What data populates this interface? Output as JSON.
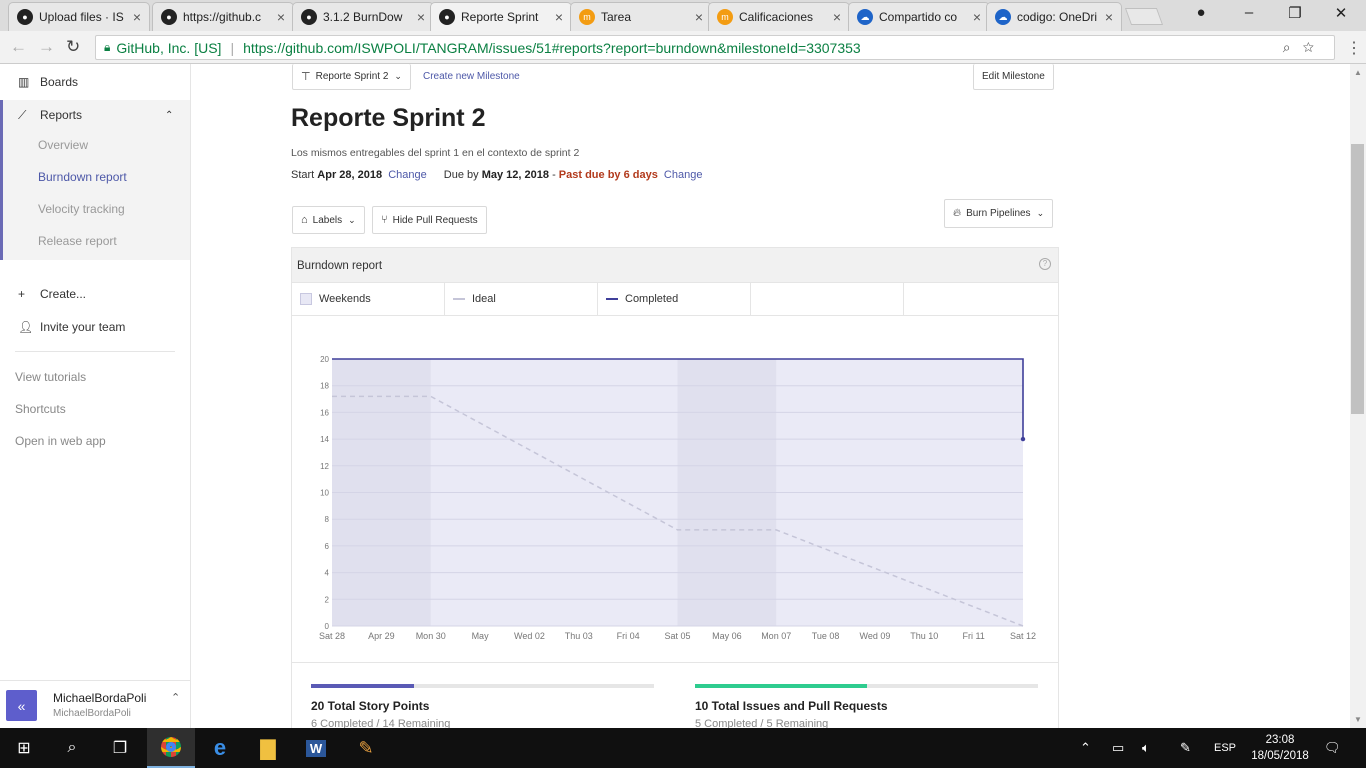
{
  "browser": {
    "tabs": [
      {
        "title": "Upload files · IS",
        "icon": "github-icon"
      },
      {
        "title": "https://github.c",
        "icon": "github-icon"
      },
      {
        "title": "3.1.2 BurnDow",
        "icon": "github-icon"
      },
      {
        "title": "Reporte Sprint",
        "icon": "github-icon",
        "active": true
      },
      {
        "title": "Tarea",
        "icon": "moodle-icon"
      },
      {
        "title": "Calificaciones",
        "icon": "moodle-icon"
      },
      {
        "title": "Compartido co",
        "icon": "onedrive-icon"
      },
      {
        "title": "codigo: OneDri",
        "icon": "onedrive-icon"
      }
    ],
    "site_identity": "GitHub, Inc. [US]",
    "url": "https://github.com/ISWPOLI/TANGRAM/issues/51#reports?report=burndown&milestoneId=3307353"
  },
  "sidebar": {
    "boards": "Boards",
    "reports": "Reports",
    "report_items": [
      "Overview",
      "Burndown report",
      "Velocity tracking",
      "Release report"
    ],
    "active_report": "Burndown report",
    "create": "Create...",
    "invite": "Invite your team",
    "links": [
      "View tutorials",
      "Shortcuts",
      "Open in web app"
    ],
    "user": {
      "name": "MichaelBordaPoli",
      "handle": "MichaelBordaPoli",
      "collapse_glyph": "«"
    }
  },
  "milestone": {
    "selector": "Reporte Sprint 2",
    "create_link": "Create new Milestone",
    "edit_button": "Edit Milestone",
    "title": "Reporte Sprint 2",
    "description": "Los mismos entregables del sprint 1 en el contexto de sprint 2",
    "start_label": "Start",
    "start_date": "Apr 28, 2018",
    "change": "Change",
    "due_label": "Due by",
    "due_date": "May 12, 2018",
    "dash": "-",
    "past_due": "Past due by 6 days"
  },
  "filters": {
    "labels": "Labels",
    "hide_prs": "Hide Pull Requests",
    "burn_pipelines": "Burn Pipelines"
  },
  "report": {
    "title": "Burndown report",
    "help": "?",
    "legend": [
      "Weekends",
      "Ideal",
      "Completed"
    ]
  },
  "colors": {
    "accent": "#4d58a8",
    "completed_line": "#3f3f9a",
    "ideal_line": "#c5c5d8",
    "area_fill": "#eaeaf6",
    "weekend_fill": "#e0e0ee",
    "past_due": "#b23a1c",
    "issues_bar": "#2ecc8f",
    "points_bar": "#5a5ab5"
  },
  "chart_data": {
    "type": "line",
    "x": [
      "Sat 28",
      "Apr 29",
      "Mon 30",
      "May",
      "Wed 02",
      "Thu 03",
      "Fri 04",
      "Sat 05",
      "May 06",
      "Mon 07",
      "Tue 08",
      "Wed 09",
      "Thu 10",
      "Fri 11",
      "Sat 12"
    ],
    "ylim": [
      0,
      20
    ],
    "yticks": [
      0,
      2,
      4,
      6,
      8,
      10,
      12,
      14,
      16,
      18,
      20
    ],
    "weekends": [
      [
        0,
        2
      ],
      [
        7,
        9
      ]
    ],
    "series": [
      {
        "name": "Ideal",
        "style": "dashed",
        "points": [
          [
            0,
            17.2
          ],
          [
            2,
            17.2
          ],
          [
            7,
            7.2
          ],
          [
            9,
            7.2
          ],
          [
            14,
            0
          ]
        ]
      },
      {
        "name": "Completed",
        "style": "solid",
        "points": [
          [
            0,
            20
          ],
          [
            14,
            20
          ],
          [
            14,
            14
          ]
        ]
      }
    ]
  },
  "stats": [
    {
      "title": "20 Total Story Points",
      "sub": "6 Completed / 14 Remaining",
      "progress": 0.3
    },
    {
      "title": "10 Total Issues and Pull Requests",
      "sub": "5 Completed / 5 Remaining",
      "progress": 0.5
    }
  ],
  "taskbar": {
    "apps": [
      "chrome-icon",
      "edge-icon",
      "file-explorer-icon",
      "word-icon",
      "paint-icon"
    ],
    "lang": "ESP",
    "time": "23:08",
    "date": "18/05/2018"
  }
}
